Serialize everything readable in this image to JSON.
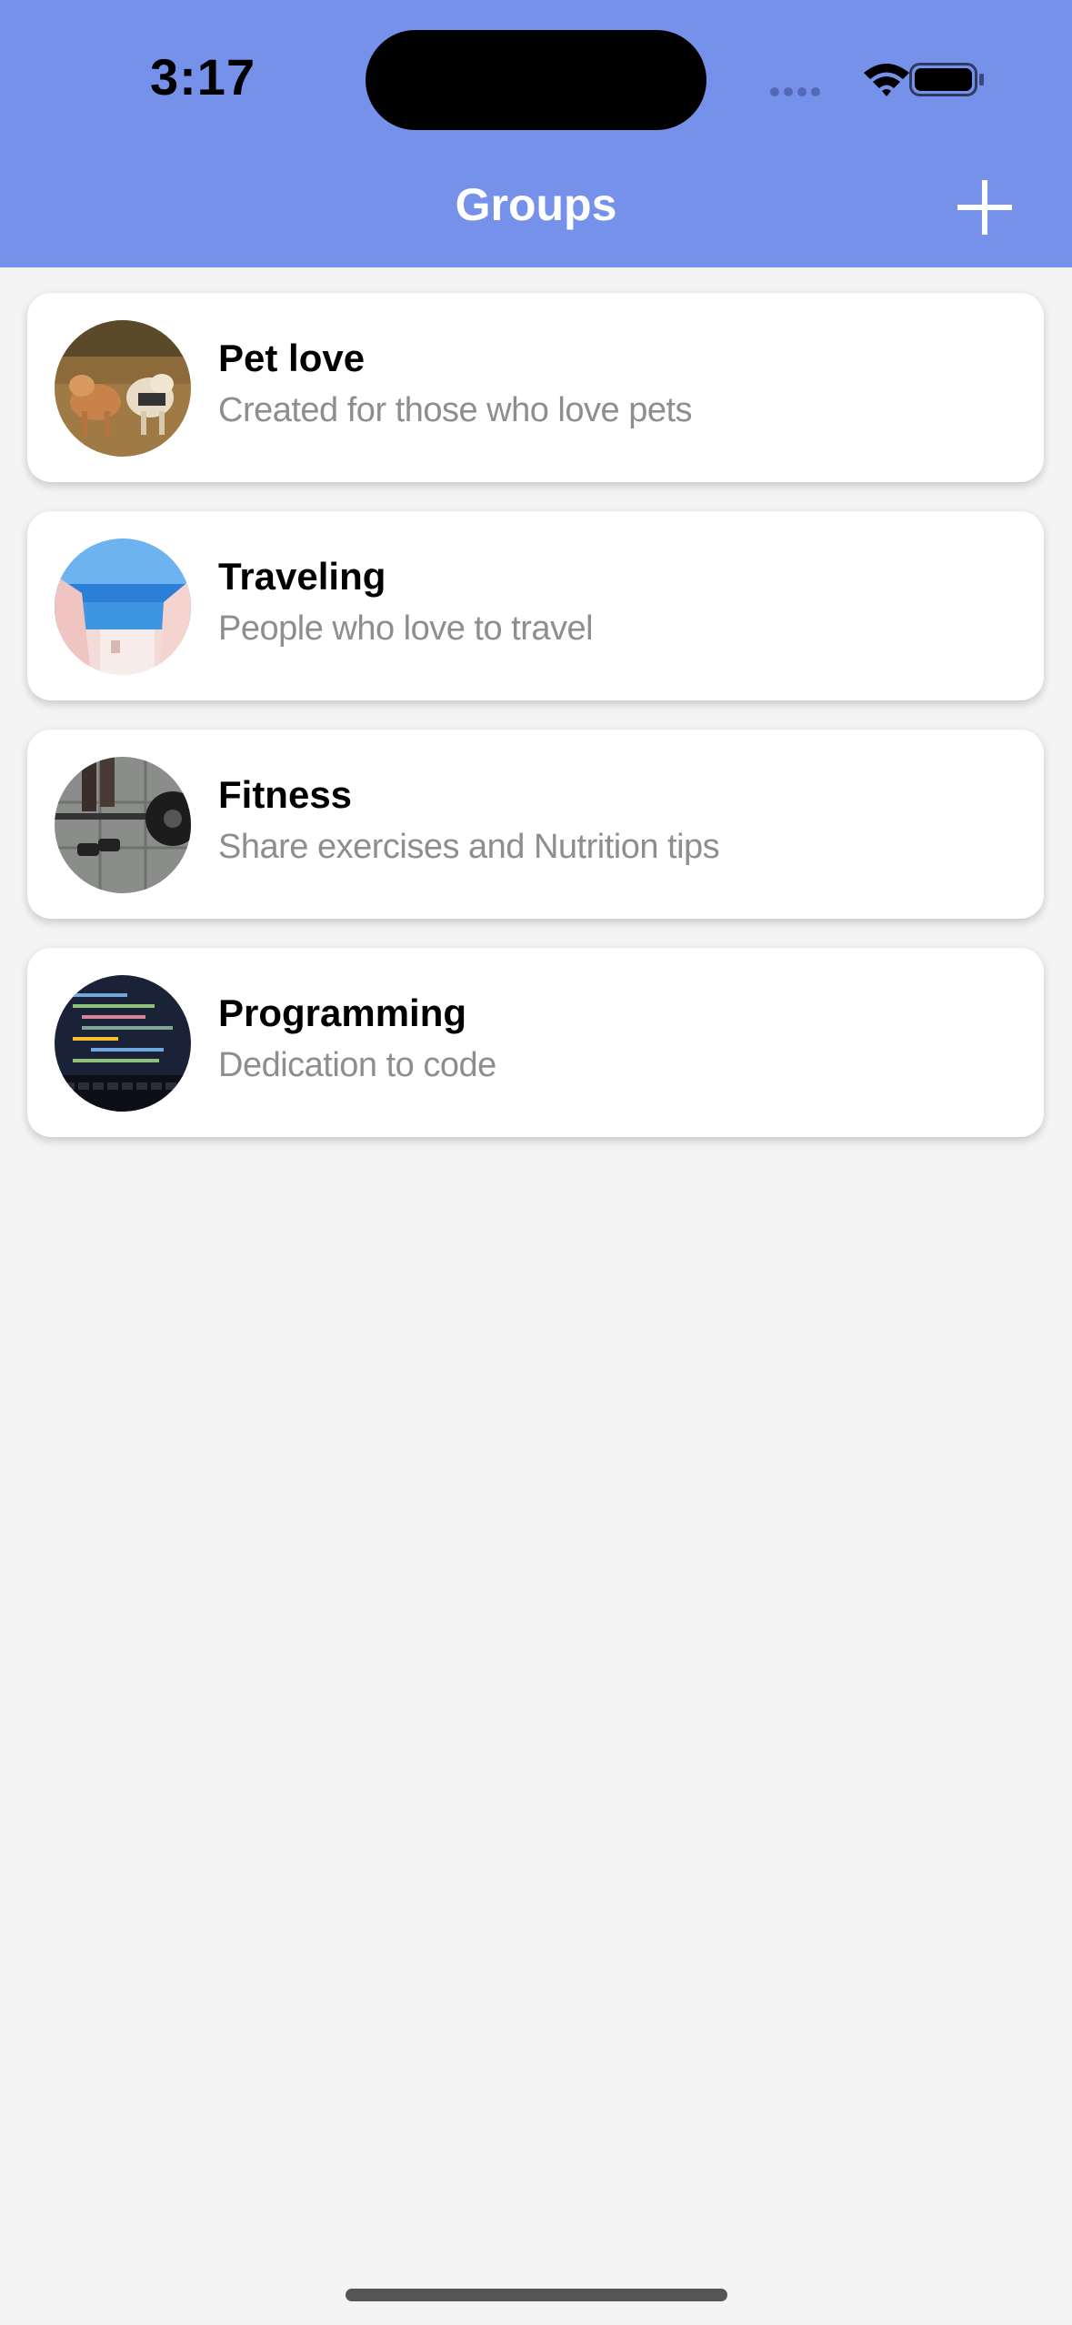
{
  "status_bar": {
    "time": "3:17",
    "icons": [
      "signal-dots-icon",
      "wifi-icon",
      "battery-icon"
    ]
  },
  "header": {
    "title": "Groups",
    "add_icon": "plus-icon",
    "background_color": "#7691ea"
  },
  "groups": [
    {
      "name": "Pet love",
      "description": "Created for those who love pets"
    },
    {
      "name": "Traveling",
      "description": "People who love to travel"
    },
    {
      "name": "Fitness",
      "description": "Share exercises and Nutrition tips"
    },
    {
      "name": "Programming",
      "description": "Dedication to code"
    }
  ]
}
